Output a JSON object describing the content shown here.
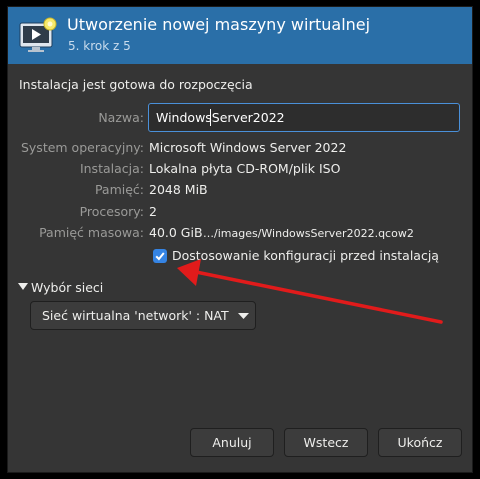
{
  "header": {
    "title": "Utworzenie nowej maszyny wirtualnej",
    "step": "5. krok z 5",
    "icon": "new-vm-monitor-icon",
    "bg_color": "#2a6fa8"
  },
  "summary": {
    "heading": "Instalacja jest gotowa do rozpoczęcia",
    "name_label": "Nazwa:",
    "name_value": "WindowsServer2022",
    "rows": [
      {
        "label": "System operacyjny:",
        "value": "Microsoft Windows Server 2022"
      },
      {
        "label": "Instalacja:",
        "value": "Lokalna płyta CD-ROM/plik ISO"
      },
      {
        "label": "Pamięć:",
        "value": "2048 MiB"
      },
      {
        "label": "Procesory:",
        "value": "2"
      },
      {
        "label": "Pamięć masowa:",
        "value": "40.0 GiB",
        "extra": "…/images/WindowsServer2022.qcow2"
      }
    ],
    "customize": {
      "label": "Dostosowanie konfiguracji przed instalacją",
      "checked": true
    }
  },
  "network": {
    "toggle_label": "Wybór sieci",
    "expanded": true,
    "selected": "Sieć wirtualna 'network' : NAT"
  },
  "buttons": {
    "cancel": "Anuluj",
    "back": "Wstecz",
    "finish": "Ukończ"
  },
  "annotation": {
    "arrow_color": "#e11b1b"
  }
}
